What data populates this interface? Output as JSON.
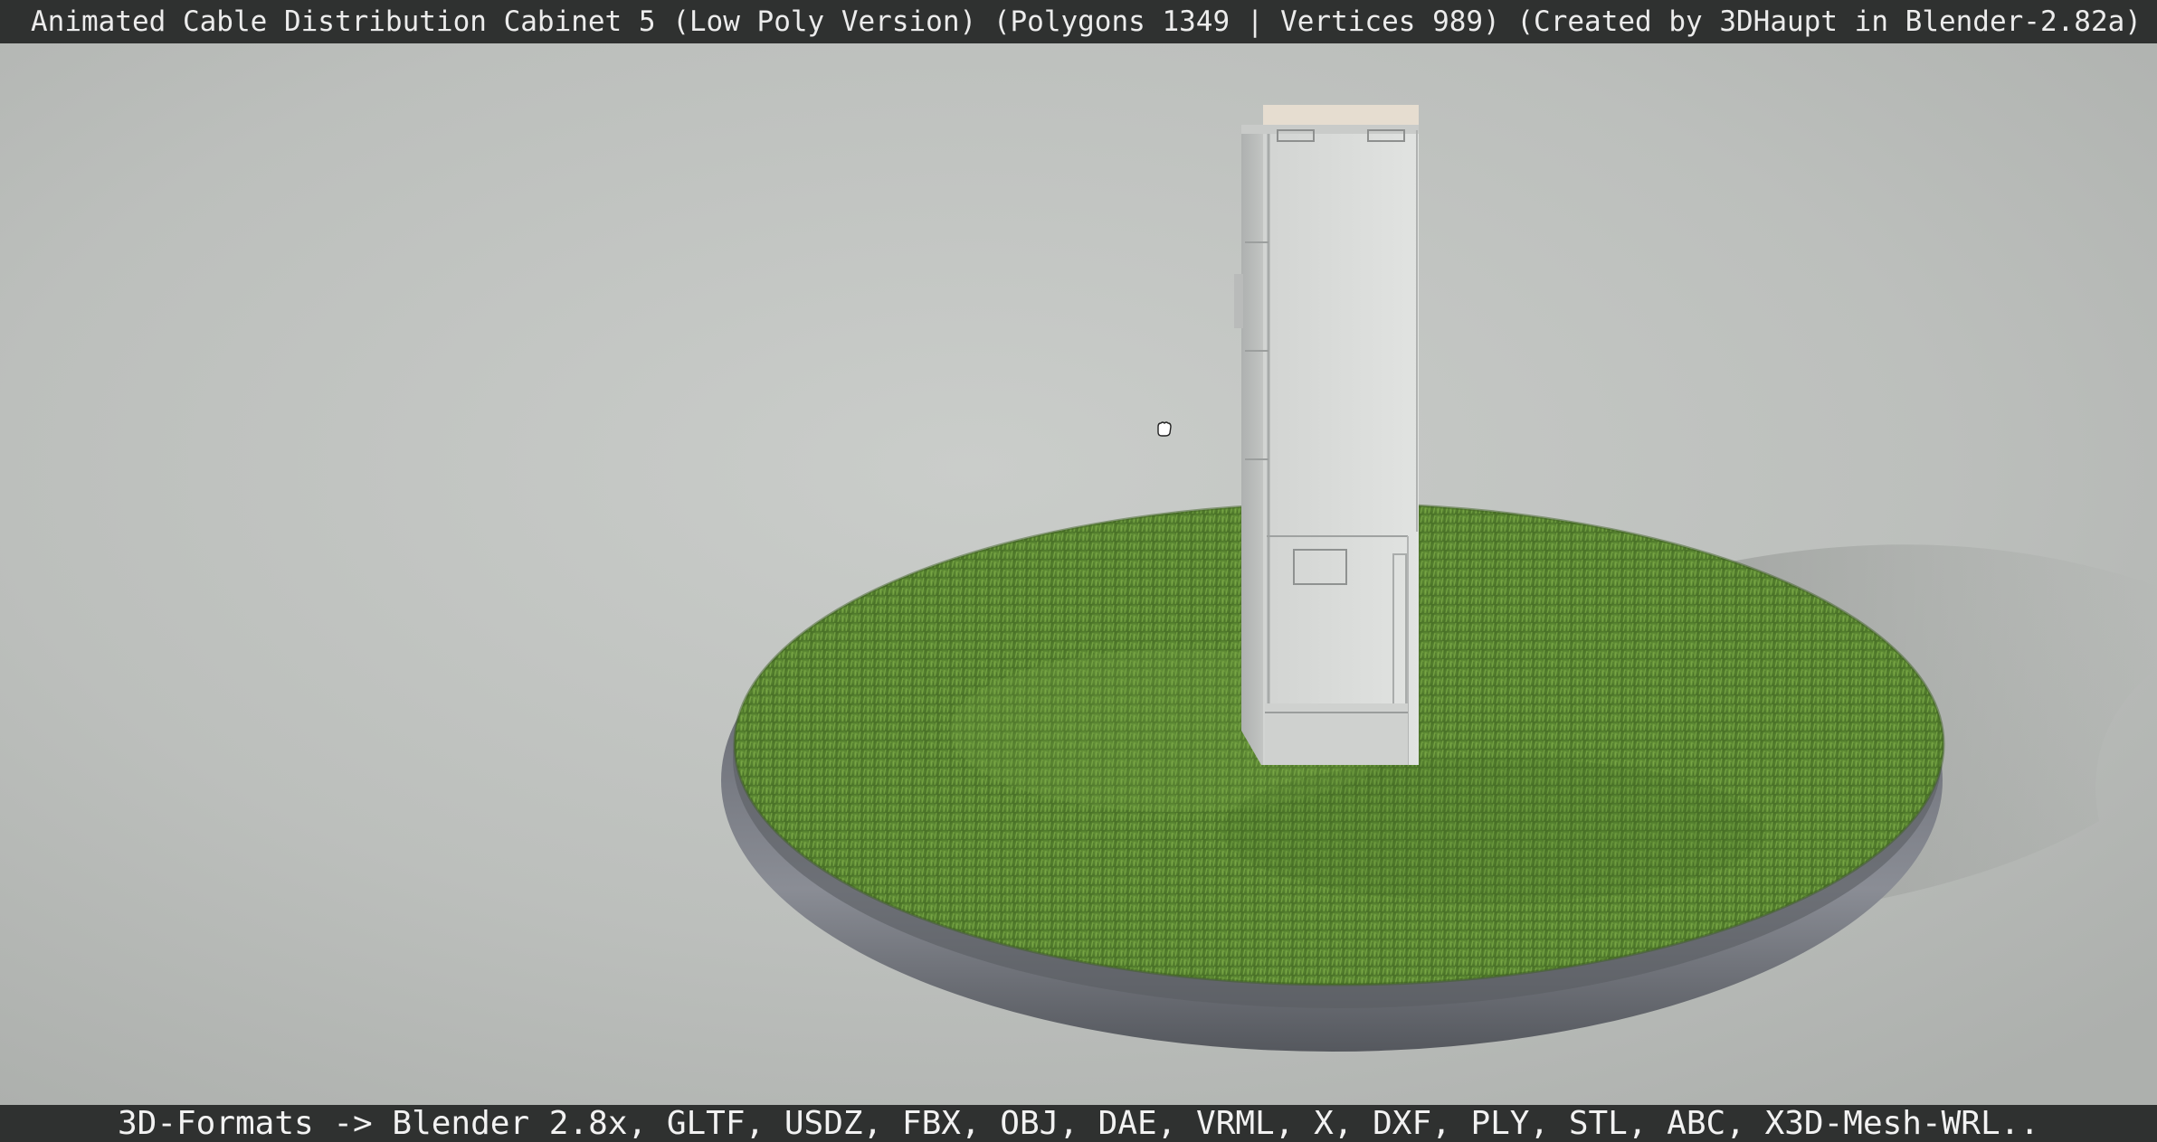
{
  "window": {
    "title": "Animated Cable Distribution Cabinet 5 (Low Poly Version) (Polygons 1349 | Vertices 989) (Created by 3DHaupt in Blender-2.82a)"
  },
  "footer": {
    "formats_text": "3D-Formats -> Blender 2.8x, GLTF, USDZ, FBX, OBJ, DAE, VRML, X, DXF, PLY, STL, ABC, X3D-Mesh-WRL.."
  },
  "scene": {
    "background_color": "#bfc2bf",
    "grass_color": "#5f8a35",
    "base_ring_color": "#7d8087",
    "cabinet_color": "#d8dad8"
  }
}
